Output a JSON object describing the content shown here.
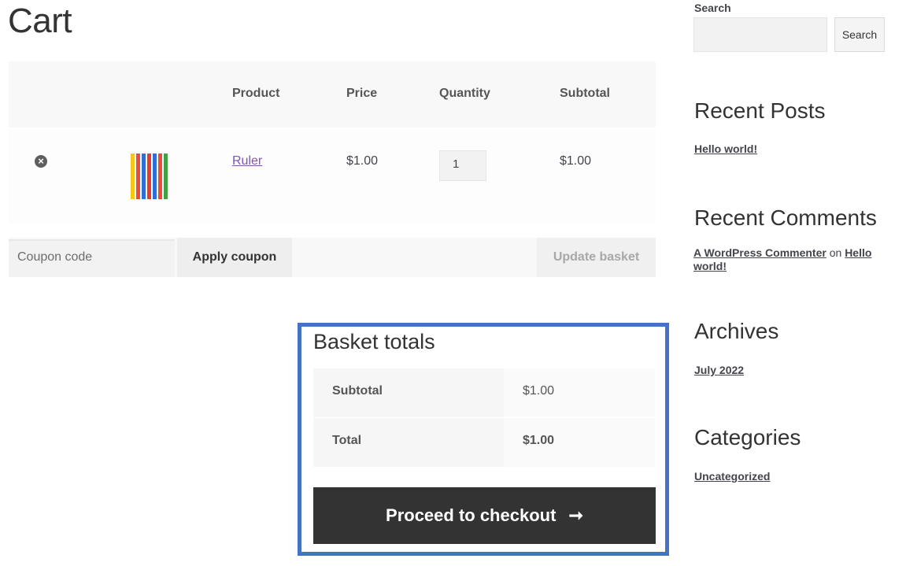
{
  "page": {
    "title": "Cart"
  },
  "cart": {
    "headers": {
      "product": "Product",
      "price": "Price",
      "quantity": "Quantity",
      "subtotal": "Subtotal"
    },
    "item": {
      "name": "Ruler",
      "price": "$1.00",
      "quantity": "1",
      "subtotal": "$1.00",
      "remove_icon": "×"
    },
    "coupon_placeholder": "Coupon code",
    "apply_coupon_label": "Apply coupon",
    "update_basket_label": "Update basket"
  },
  "totals": {
    "title": "Basket totals",
    "subtotal_label": "Subtotal",
    "subtotal_value": "$1.00",
    "total_label": "Total",
    "total_value": "$1.00",
    "checkout_label": "Proceed to checkout",
    "checkout_arrow": "➞"
  },
  "sidebar": {
    "search_label": "Search",
    "search_button": "Search",
    "recent_posts_title": "Recent Posts",
    "recent_post": "Hello world!",
    "recent_comments_title": "Recent Comments",
    "comment_author": "A WordPress Commenter",
    "comment_on": "on",
    "comment_post": "Hello world!",
    "archives_title": "Archives",
    "archive_item": "July 2022",
    "categories_title": "Categories",
    "category_item": "Uncategorized"
  },
  "colors": {
    "accent_frame": "#4472c4",
    "link_purple": "#7f54b3",
    "checkout_bg": "#333333"
  }
}
